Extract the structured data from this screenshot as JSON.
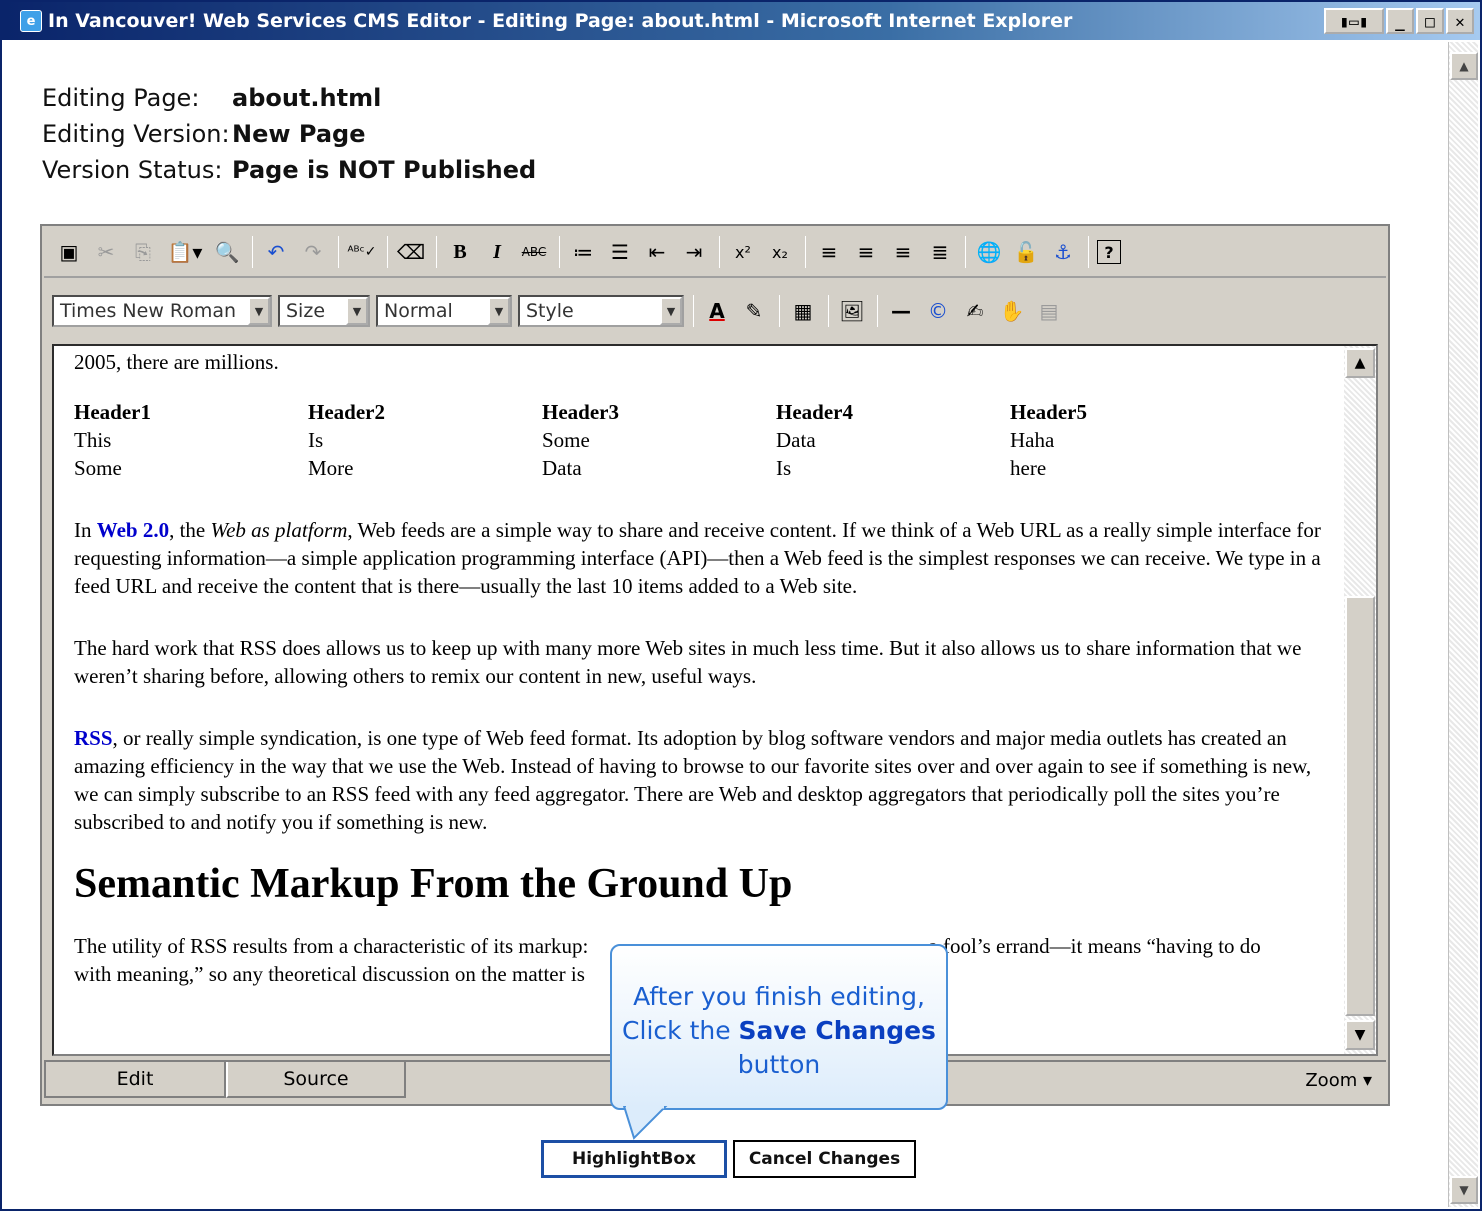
{
  "window": {
    "title": "In Vancouver! Web Services CMS Editor - Editing Page: about.html - Microsoft Internet Explorer",
    "controls": [
      "minimize",
      "restore",
      "close"
    ]
  },
  "info": {
    "page_label": "Editing Page:",
    "page_value": "about.html",
    "version_label": "Editing Version:",
    "version_value": "New Page",
    "status_label": "Version Status:",
    "status_value": "Page is NOT Published"
  },
  "toolbar2": {
    "font": "Times New Roman",
    "size": "Size",
    "format": "Normal",
    "style": "Style"
  },
  "content": {
    "intro_tail": "2005, there are millions.",
    "table": {
      "headers": [
        "Header1",
        "Header2",
        "Header3",
        "Header4",
        "Header5"
      ],
      "rows": [
        [
          "This",
          "Is",
          "Some",
          "Data",
          "Haha"
        ],
        [
          "Some",
          "More",
          "Data",
          "Is",
          "here"
        ]
      ]
    },
    "p1_a": "In ",
    "p1_link": "Web 2.0",
    "p1_b": ", the ",
    "p1_italic": "Web as platform",
    "p1_c": ", Web feeds are a simple way to share and receive content. If we think of a Web URL as a really simple interface for requesting information—a simple application programming interface (API)—then a Web feed is the simplest responses we can receive. We type in a feed URL and receive the content that is there—usually the last 10 items added to a Web site.",
    "p2": "The hard work that RSS does allows us to keep up with many more Web sites in much less time. But it also allows us to share information that we weren’t sharing before, allowing others to remix our content in new, useful ways.",
    "p3_link": "RSS",
    "p3": ", or really simple syndication, is one type of Web feed format. Its adoption by blog software vendors and major media outlets has created an amazing efficiency in the way that we use the Web. Instead of having to browse to our favorite sites over and over again to see if something is new, we can simply subscribe to an RSS feed with any feed aggregator. There are Web and desktop aggregators that periodically poll the sites you’re subscribed to and notify you if something is new.",
    "heading": "Semantic Markup From the Ground Up",
    "p4_line1_a": "The utility of RSS results from a characteristic of its markup:",
    "p4_line1_b": "a fool’s errand—it means “having to do",
    "p4_line2": "with meaning,” so any theoretical discussion on the matter is"
  },
  "tabs": {
    "edit": "Edit",
    "source": "Source",
    "zoom": "Zoom ▾"
  },
  "buttons": {
    "save": "HighlightBox",
    "cancel": "Cancel Changes"
  },
  "callout": {
    "line1": "After you finish editing,",
    "line2_a": "Click the ",
    "line2_b": "Save Changes",
    "line3": "button"
  }
}
